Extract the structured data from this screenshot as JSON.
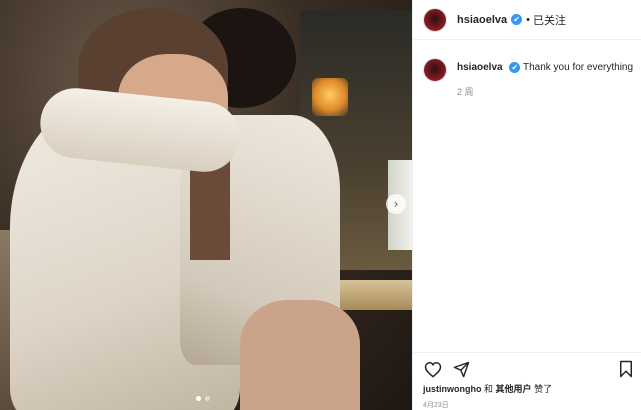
{
  "post": {
    "username": "hsiaoelva",
    "bullet": "•",
    "follow_status": "已关注",
    "verified_mark": "✔",
    "caption": "Thank you for everything",
    "caption_time": "2 周",
    "liked_by_user": "justinwongho",
    "liked_by_join": "和",
    "liked_by_others": "其他用户",
    "liked_by_suffix": "赞了",
    "date": "4月23日",
    "carousel": {
      "total": 2,
      "active": 0,
      "next_glyph": "›"
    }
  },
  "icons": {
    "like": "heart-outline-icon",
    "share": "paper-plane-icon",
    "save": "bookmark-outline-icon",
    "next": "chevron-right-icon",
    "verified": "verified-badge-icon"
  },
  "colors": {
    "verified_blue": "#3897f0",
    "text": "#262626",
    "muted": "#8e8e8e",
    "divider": "#efefef"
  }
}
